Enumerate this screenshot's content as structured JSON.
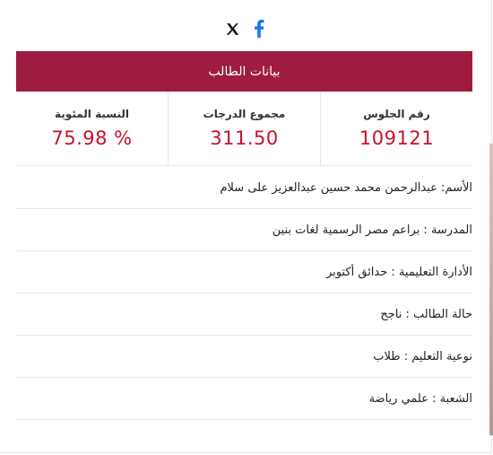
{
  "share": {
    "twitter_icon": "x-icon",
    "facebook_icon": "facebook-icon",
    "facebook_color": "#1877f2",
    "twitter_color": "#111111"
  },
  "header": {
    "title": "بيانات الطالب",
    "bg_color": "#9e1c3f"
  },
  "stats": [
    {
      "label": "رقم الجلوس",
      "value": "109121"
    },
    {
      "label": "مجموع الدرجات",
      "value": "311.50"
    },
    {
      "label": "النسبة المئوية",
      "value": "75.98 %"
    }
  ],
  "rows": [
    {
      "key": "الأسم",
      "value": "عبدالرحمن محمد حسين عبدالعزيز على سلام"
    },
    {
      "key": "المدرسة",
      "value": "براعم مصر الرسمية لغات بنين"
    },
    {
      "key": "الأدارة التعليمية",
      "value": "حدائق أكتوبر"
    },
    {
      "key": "حالة الطالب",
      "value": "ناجح"
    },
    {
      "key": "نوعية التعليم",
      "value": "طلاب"
    },
    {
      "key": "الشعبة",
      "value": "علمي رياضة"
    }
  ],
  "accent_value_color": "#c8102e"
}
